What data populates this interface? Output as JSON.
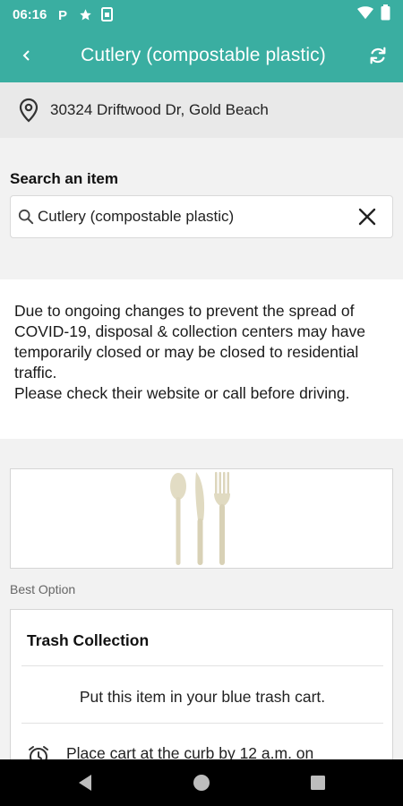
{
  "status_bar": {
    "time": "06:16",
    "icons": [
      "parking-icon",
      "star-icon",
      "sim-card-icon"
    ],
    "right_icons": [
      "wifi-icon",
      "battery-icon"
    ]
  },
  "app_bar": {
    "title": "Cutlery (compostable plastic)",
    "back_icon": "chevron-left-icon",
    "refresh_icon": "refresh-icon"
  },
  "location": {
    "icon": "location-pin-icon",
    "address": "30324 Driftwood Dr, Gold Beach"
  },
  "search": {
    "label": "Search an item",
    "value": "Cutlery (compostable plastic)",
    "search_icon": "search-icon",
    "clear_icon": "close-icon"
  },
  "notice": {
    "text": "Due to ongoing changes to prevent the spread of COVID-19, disposal & collection centers may have temporarily closed or may be closed to residential traffic.\nPlease check their website or call before driving."
  },
  "item_image": {
    "icon": "cutlery-image"
  },
  "best_option": {
    "label": "Best Option",
    "title": "Trash Collection",
    "instruction": "Put this item in your blue trash cart.",
    "schedule_icon": "alarm-clock-icon",
    "schedule_text": "Place cart at the curb by 12 a.m. on"
  },
  "nav_bar": {
    "buttons": [
      "back-triangle-icon",
      "home-circle-icon",
      "recents-square-icon"
    ]
  },
  "colors": {
    "primary": "#3aaea1",
    "nav_bar": "#000000"
  }
}
